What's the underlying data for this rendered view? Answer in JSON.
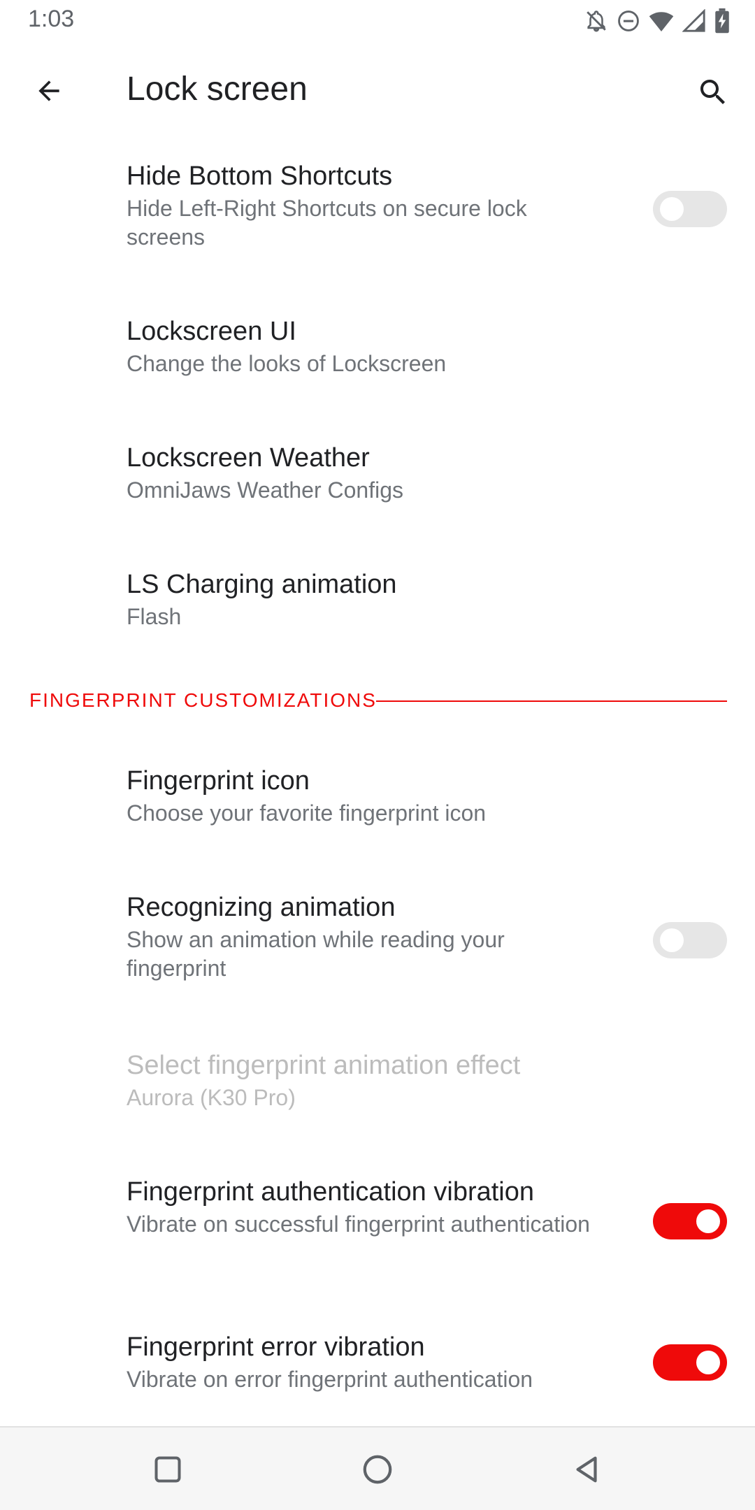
{
  "status_bar": {
    "time": "1:03",
    "icons": [
      "notifications-off-icon",
      "do-not-disturb-icon",
      "wifi-icon",
      "cellular-signal-icon",
      "battery-charging-icon"
    ]
  },
  "app_bar": {
    "title": "Lock screen",
    "back_icon": "arrow-back-icon",
    "search_icon": "search-icon"
  },
  "preferences_top": [
    {
      "title": "Hide Bottom Shortcuts",
      "summary": "Hide Left-Right Shortcuts on secure lock screens",
      "toggle": "off"
    },
    {
      "title": "Lockscreen UI",
      "summary": "Change the looks of Lockscreen"
    },
    {
      "title": "Lockscreen Weather",
      "summary": "OmniJaws Weather Configs"
    },
    {
      "title": "LS Charging animation",
      "summary": "Flash"
    }
  ],
  "section": {
    "label": "FINGERPRINT CUSTOMIZATIONS"
  },
  "preferences_fingerprint": [
    {
      "title": "Fingerprint icon",
      "summary": "Choose your favorite fingerprint icon"
    },
    {
      "title": "Recognizing animation",
      "summary": "Show an animation while reading your fingerprint",
      "toggle": "off"
    },
    {
      "title": "Select fingerprint animation effect",
      "summary": "Aurora (K30 Pro)",
      "enabled": false
    },
    {
      "title": "Fingerprint authentication vibration",
      "summary": "Vibrate on successful fingerprint authentication",
      "toggle": "on"
    },
    {
      "title": "Fingerprint error vibration",
      "summary": "Vibrate on error fingerprint authentication",
      "toggle": "on"
    }
  ],
  "nav_bar": {
    "recents_icon": "recents-square-icon",
    "home_icon": "home-circle-icon",
    "back_icon": "back-triangle-icon"
  },
  "colors": {
    "accent": "#ef0a0a",
    "toggle_off_track": "#e6e6e6",
    "text_primary": "#202124",
    "text_secondary": "#6f7378",
    "text_disabled": "#bcbcbc"
  }
}
